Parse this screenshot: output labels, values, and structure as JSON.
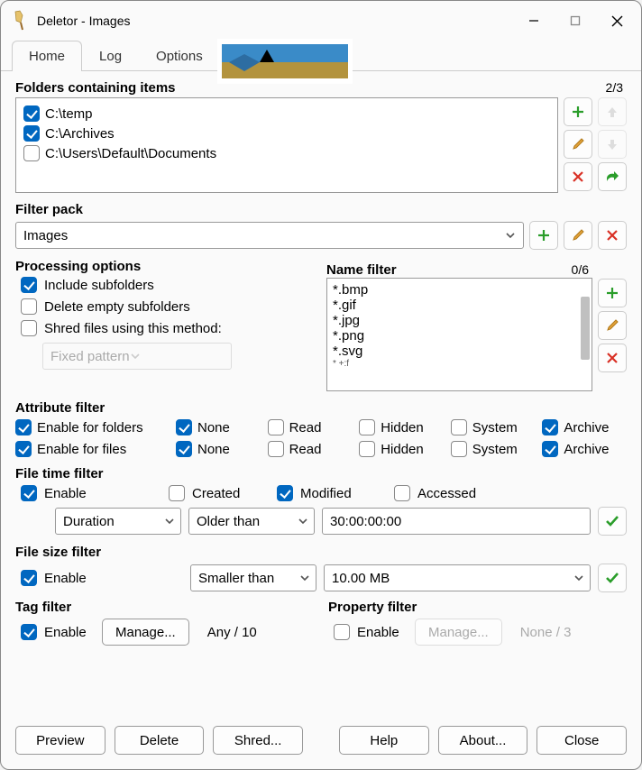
{
  "window": {
    "title": "Deletor - Images"
  },
  "tabs": {
    "home": "Home",
    "log": "Log",
    "options": "Options"
  },
  "folders": {
    "label": "Folders containing items",
    "counter": "2/3",
    "items": [
      {
        "path": "C:\\temp",
        "checked": true
      },
      {
        "path": "C:\\Archives",
        "checked": true
      },
      {
        "path": "C:\\Users\\Default\\Documents",
        "checked": false
      }
    ]
  },
  "filter_pack": {
    "label": "Filter pack",
    "value": "Images"
  },
  "processing": {
    "label": "Processing options",
    "include_sub": "Include subfolders",
    "delete_empty": "Delete empty subfolders",
    "shred": "Shred files using this method:",
    "shred_method": "Fixed pattern"
  },
  "name_filter": {
    "label": "Name filter",
    "counter": "0/6",
    "items": [
      "*.bmp",
      "*.gif",
      "*.jpg",
      "*.png",
      "*.svg",
      "*.tif"
    ]
  },
  "attr": {
    "label": "Attribute filter",
    "enable_folders": "Enable for folders",
    "enable_files": "Enable for files",
    "none": "None",
    "read": "Read",
    "hidden": "Hidden",
    "system": "System",
    "archive": "Archive"
  },
  "time": {
    "label": "File time filter",
    "enable": "Enable",
    "created": "Created",
    "modified": "Modified",
    "accessed": "Accessed",
    "mode": "Duration",
    "op": "Older than",
    "value": "30:00:00:00"
  },
  "size": {
    "label": "File size filter",
    "enable": "Enable",
    "op": "Smaller than",
    "value": "10.00 MB"
  },
  "tag": {
    "label": "Tag filter",
    "enable": "Enable",
    "manage": "Manage...",
    "desc": "Any / 10"
  },
  "prop": {
    "label": "Property filter",
    "enable": "Enable",
    "manage": "Manage...",
    "desc": "None / 3"
  },
  "buttons": {
    "preview": "Preview",
    "delete": "Delete",
    "shred": "Shred...",
    "help": "Help",
    "about": "About...",
    "close": "Close"
  },
  "icons": {
    "plus": "plus-icon",
    "up": "arrow-up-icon",
    "pencil": "pencil-icon",
    "down": "arrow-down-icon",
    "x": "x-icon",
    "share": "share-icon",
    "check": "check-icon"
  }
}
